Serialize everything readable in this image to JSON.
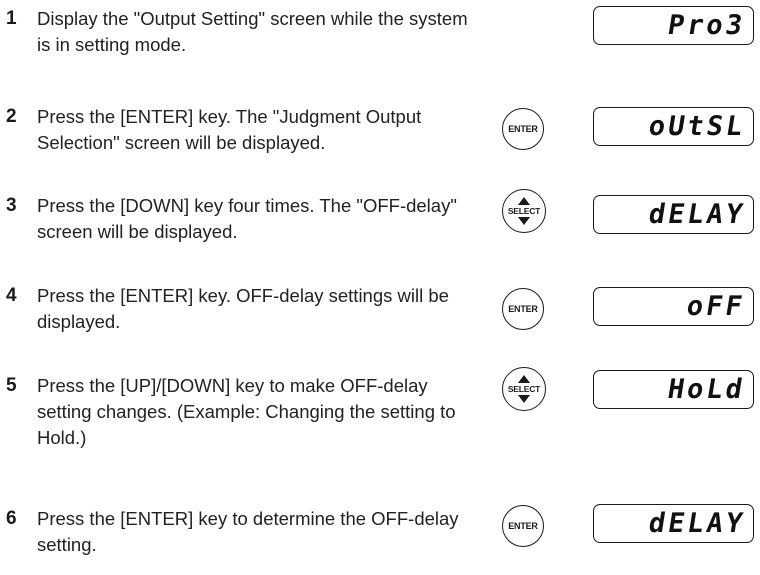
{
  "steps": [
    {
      "number": "1",
      "text": "Display the \"Output Setting\" screen while the system is in setting mode.",
      "key": null,
      "display": "Pro3"
    },
    {
      "number": "2",
      "text": "Press the [ENTER] key. The \"Judgment Output Selection\" screen will be displayed.",
      "key": {
        "icon": "enter-key-icon",
        "label": "ENTER"
      },
      "display": "oUtSL"
    },
    {
      "number": "3",
      "text": "Press the [DOWN] key four times. The \"OFF-delay\" screen will be displayed.",
      "key": {
        "icon": "select-key-icon",
        "label": "SELECT"
      },
      "display": "dELAY"
    },
    {
      "number": "4",
      "text": "Press the [ENTER] key. OFF-delay settings will be displayed.",
      "key": {
        "icon": "enter-key-icon",
        "label": "ENTER"
      },
      "display": "oFF"
    },
    {
      "number": "5",
      "text": "Press the [UP]/[DOWN] key to make OFF-delay setting changes. (Example: Changing the setting to Hold.)",
      "key": {
        "icon": "select-key-icon",
        "label": "SELECT"
      },
      "display": "HoLd"
    },
    {
      "number": "6",
      "text": "Press the [ENTER] key to determine the OFF-delay setting.",
      "key": {
        "icon": "enter-key-icon",
        "label": "ENTER"
      },
      "display": "dELAY"
    }
  ]
}
